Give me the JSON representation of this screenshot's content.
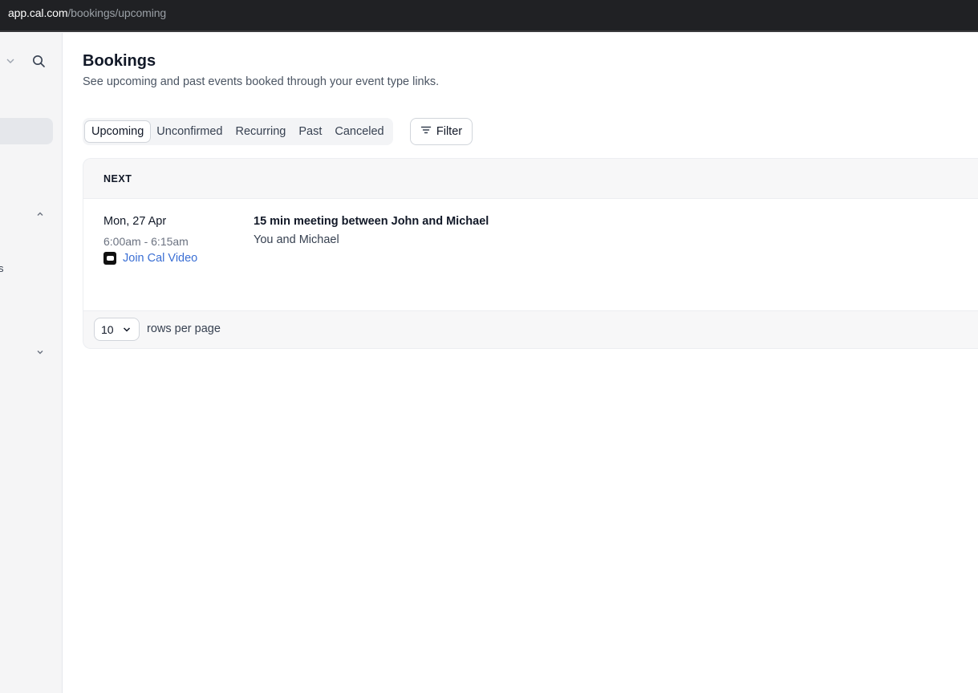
{
  "browser": {
    "url_host": "app.cal.com",
    "url_path": "/bookings/upcoming"
  },
  "sidebar": {
    "clipped_label": "s"
  },
  "page": {
    "title": "Bookings",
    "subtitle": "See upcoming and past events booked through your event type links."
  },
  "tabs": [
    {
      "label": "Upcoming",
      "active": true
    },
    {
      "label": "Unconfirmed",
      "active": false
    },
    {
      "label": "Recurring",
      "active": false
    },
    {
      "label": "Past",
      "active": false
    },
    {
      "label": "Canceled",
      "active": false
    }
  ],
  "filter": {
    "label": "Filter",
    "icon": "filter-icon"
  },
  "table": {
    "section_header": "NEXT",
    "bookings": [
      {
        "date": "Mon, 27 Apr",
        "time": "6:00am - 6:15am",
        "join_label": "Join Cal Video",
        "title": "15 min meeting between John and Michael",
        "attendees": "You and Michael"
      }
    ]
  },
  "pagination": {
    "rows_per_page": "10",
    "rows_label": "rows per page"
  },
  "colors": {
    "link": "#3b6fd4",
    "topbar": "#202124",
    "sidebar": "#f5f5f6"
  }
}
